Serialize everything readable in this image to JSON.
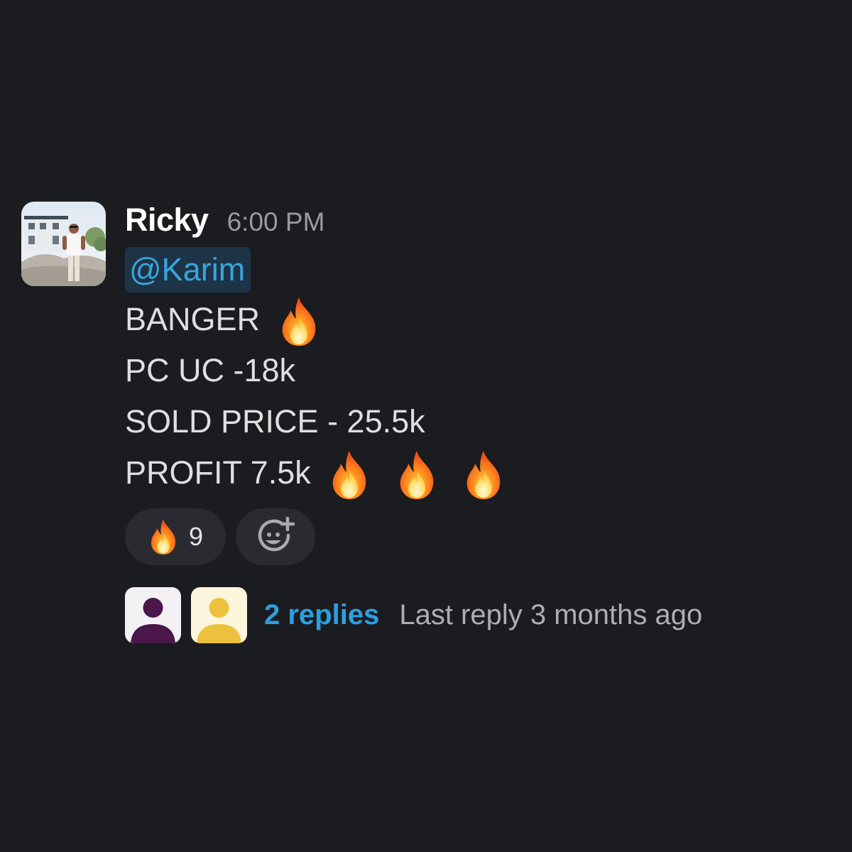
{
  "message": {
    "author": "Ricky",
    "timestamp": "6:00 PM",
    "mention": "@Karim",
    "lines": [
      "BANGER",
      "PC UC -18k",
      "SOLD PRICE - 25.5k",
      "PROFIT 7.5k"
    ],
    "line_emoji_counts": [
      1,
      0,
      0,
      3
    ]
  },
  "reactions": [
    {
      "emoji": "fire-emoji",
      "count": "9"
    }
  ],
  "add_reaction_icon": "add-reaction-icon",
  "thread": {
    "participant_avatars": [
      {
        "icon": "user-avatar-icon",
        "bg": "#f4f1f4",
        "fg": "#4b1649"
      },
      {
        "icon": "user-avatar-icon",
        "bg": "#fdf6dc",
        "fg": "#ecc13d"
      }
    ],
    "replies_label": "2 replies",
    "last_reply_label": "Last reply 3 months ago"
  },
  "colors": {
    "background": "#1b1c20",
    "mention_bg": "#1d3447",
    "mention_text": "#3aa4dc",
    "link": "#2c9fe0",
    "pill_bg": "#2a2b30"
  }
}
